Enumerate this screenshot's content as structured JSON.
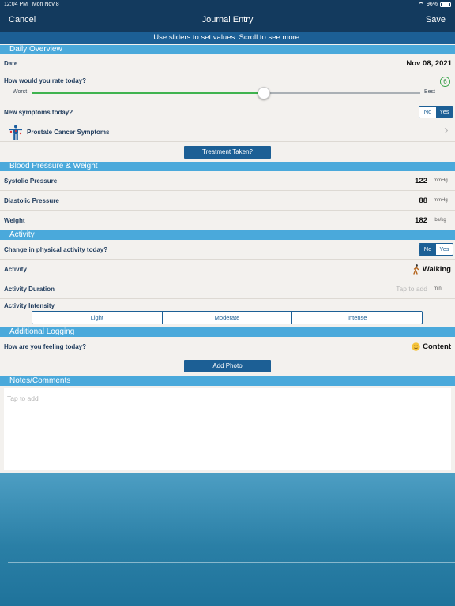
{
  "status_bar": {
    "time": "12:04 PM",
    "date": "Mon Nov 8",
    "battery": "96%",
    "battery_level": 0.96
  },
  "nav": {
    "cancel": "Cancel",
    "title": "Journal Entry",
    "save": "Save"
  },
  "instruction": "Use sliders to set values. Scroll to see more.",
  "daily_overview": {
    "header": "Daily Overview",
    "date_label": "Date",
    "date_value": "Nov 08, 2021",
    "rating_label": "How would you rate today?",
    "rating_value": "6",
    "rating_fraction": 0.6,
    "slider_min_label": "Worst",
    "slider_max_label": "Best",
    "symptoms_label": "New symptoms today?",
    "symptoms_toggle": {
      "no": "No",
      "yes": "Yes",
      "selected": "Yes"
    },
    "symptom_item": "Prostate Cancer Symptoms",
    "treatment_button": "Treatment Taken?"
  },
  "blood_pressure": {
    "header": "Blood Pressure & Weight",
    "systolic_label": "Systolic Pressure",
    "systolic_value": "122",
    "systolic_unit": "mmHg",
    "diastolic_label": "Diastolic Pressure",
    "diastolic_value": "88",
    "diastolic_unit": "mmHg",
    "weight_label": "Weight",
    "weight_value": "182",
    "weight_unit": "lbs/kg"
  },
  "activity": {
    "header": "Activity",
    "change_label": "Change in physical activity today?",
    "change_toggle": {
      "no": "No",
      "yes": "Yes",
      "selected": "No"
    },
    "activity_label": "Activity",
    "activity_value": "Walking",
    "duration_label": "Activity Duration",
    "duration_placeholder": "Tap to add",
    "duration_unit": "min",
    "intensity_label": "Activity Intensity",
    "intensity_options": [
      "Light",
      "Moderate",
      "Intense"
    ]
  },
  "additional": {
    "header": "Additional Logging",
    "feeling_label": "How are you feeling today?",
    "feeling_value": "Content",
    "add_photo": "Add Photo"
  },
  "notes": {
    "header": "Notes/Comments",
    "placeholder": "Tap to add"
  },
  "colors": {
    "nav_bg": "#133a5e",
    "section_header": "#4aa9db",
    "primary": "#1c5f95",
    "slider_active": "#3fb34f"
  },
  "icons": [
    "wifi-icon",
    "battery-icon",
    "body-figure-icon",
    "chevron-right-icon",
    "walking-person-icon",
    "smiley-face-icon"
  ]
}
